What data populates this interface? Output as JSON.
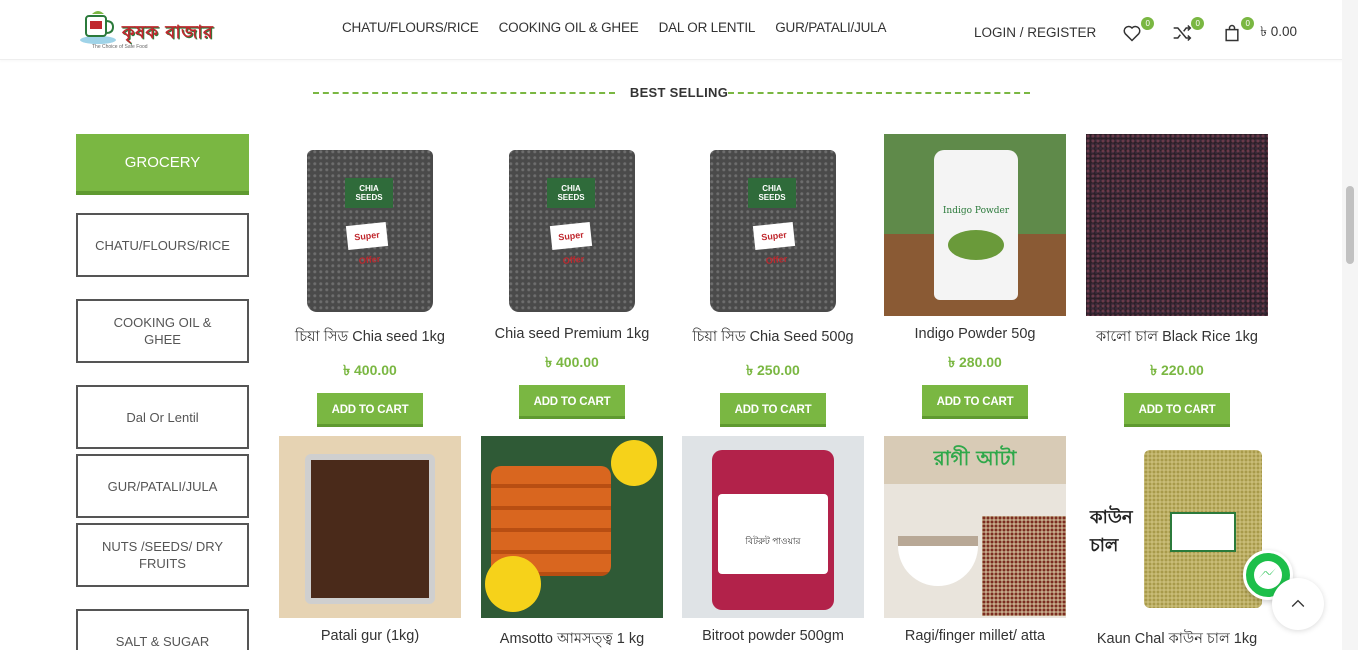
{
  "header": {
    "brand": "কৃষক বাজার",
    "tagline": "The Choice of Safe Food",
    "nav": [
      "CHATU/FLOURS/RICE",
      "COOKING OIL & GHEE",
      "DAL OR LENTIL",
      "GUR/PATALI/JULA"
    ],
    "login": "LOGIN / REGISTER",
    "wishlist_count": "0",
    "compare_count": "0",
    "cart_count": "0",
    "cart_total": "৳ 0.00"
  },
  "section": {
    "title": "BEST SELLING"
  },
  "sidebar": {
    "heading": "GROCERY",
    "items": [
      "CHATU/FLOURS/RICE",
      "COOKING OIL & GHEE",
      "Dal Or Lentil",
      "GUR/PATALI/JULA",
      "NUTS /SEEDS/ DRY FRUITS",
      "SALT & SUGAR"
    ]
  },
  "products": [
    {
      "name": "চিয়া সিড Chia seed 1kg",
      "price": "৳ 400.00",
      "button": "ADD TO CART",
      "image_label": "CHIA SEEDS",
      "image_sticker": "Super Offer"
    },
    {
      "name": "Chia seed Premium 1kg",
      "price": "৳ 400.00",
      "button": "ADD TO CART",
      "image_label": "CHIA SEEDS",
      "image_sticker": "Super Offer"
    },
    {
      "name": "চিয়া সিড Chia Seed 500g",
      "price": "৳ 250.00",
      "button": "ADD TO CART",
      "image_label": "CHIA SEEDS",
      "image_sticker": "Super Offer"
    },
    {
      "name": "Indigo Powder 50g",
      "price": "৳ 280.00",
      "button": "ADD TO CART",
      "image_label": "Indigo Powder"
    },
    {
      "name": "কালো চাল Black Rice 1kg",
      "price": "৳ 220.00",
      "button": "ADD TO CART"
    },
    {
      "name": "Patali gur (1kg)"
    },
    {
      "name": "Amsotto আমসত্ত্ব 1 kg"
    },
    {
      "name": "Bitroot powder 500gm",
      "image_label": "বিটরুট পাওয়ার"
    },
    {
      "name": "Ragi/finger millet/ atta",
      "image_label": "রাগী আটা"
    },
    {
      "name": "Kaun Chal কাউন চাল 1kg",
      "image_label": "কাউন চাল"
    }
  ],
  "colors": {
    "accent": "#7ab742",
    "accent_dark": "#5f9a30",
    "brand_red": "#c0282e"
  }
}
